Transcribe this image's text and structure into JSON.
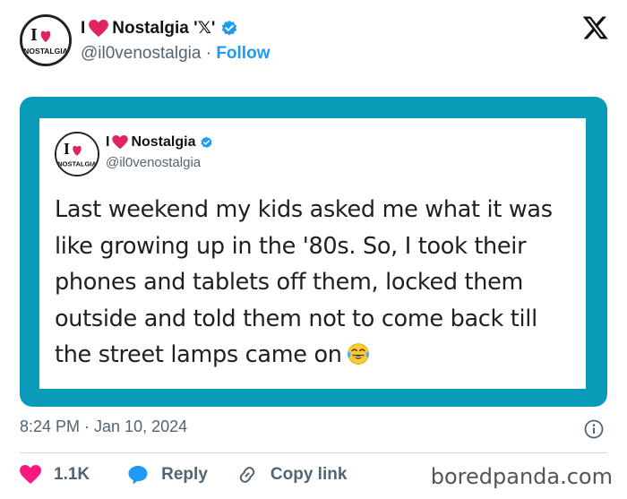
{
  "author": {
    "display_name_prefix": "I",
    "display_name_suffix": "Nostalgia '𝕏'",
    "handle": "@il0venostalgia",
    "separator": "·",
    "follow_label": "Follow",
    "avatar_text_top": "I",
    "avatar_text_bottom": "NOSTALGIA"
  },
  "embedded_tweet": {
    "display_name_prefix": "I",
    "display_name_suffix": "Nostalgia",
    "handle": "@il0venostalgia",
    "lines": [
      "Last weekend my kids asked me what it was",
      "like growing up in the '80s.  So, I took their",
      "phones and tablets off them, locked them",
      "outside and told them not to come back till",
      "the street lamps came on"
    ],
    "emoji_icon": "tears-of-joy-emoji"
  },
  "timestamp": "8:24 PM · Jan 10, 2024",
  "actions": {
    "like_count": "1.1K",
    "reply_label": "Reply",
    "copy_link_label": "Copy link"
  },
  "watermark": "boredpanda.com",
  "colors": {
    "frame": "#0a9bb8",
    "link_blue": "#1d9bf0",
    "like_pink": "#f91880",
    "heart_red": "#e0245e",
    "secondary_text": "#536471"
  }
}
